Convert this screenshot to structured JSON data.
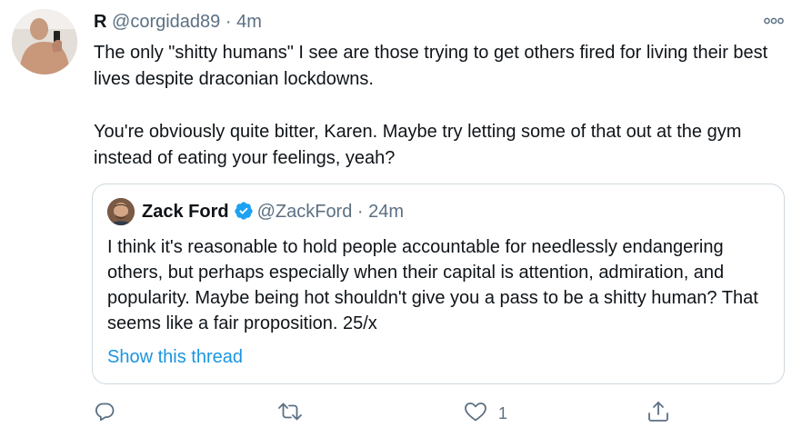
{
  "tweet": {
    "display_name": "R",
    "handle": "@corgidad89",
    "separator": "·",
    "time": "4m",
    "more_icon": "more-dots-icon",
    "paragraphs": [
      "The only \"shitty humans\" I see are those trying to get others fired for living their best lives despite draconian lockdowns.",
      "You're obviously quite bitter, Karen. Maybe try letting some of that out at the gym instead of eating your feelings, yeah?"
    ]
  },
  "quoted_tweet": {
    "display_name": "Zack Ford",
    "verified_icon": "verified-badge-icon",
    "handle": "@ZackFord",
    "separator": "·",
    "time": "24m",
    "text": "I think it's reasonable to hold people accountable for needlessly endangering others, but perhaps especially when their capital is attention, admiration, and popularity. Maybe being hot shouldn't give you a pass to be a shitty human? That seems like a fair proposition. 25/x",
    "show_thread_label": "Show this thread"
  },
  "actions": {
    "reply": {
      "icon": "reply-icon"
    },
    "retweet": {
      "icon": "retweet-icon"
    },
    "like": {
      "icon": "heart-icon",
      "count": "1"
    },
    "share": {
      "icon": "share-icon"
    }
  },
  "colors": {
    "text": "#0f1419",
    "muted": "#5b7083",
    "link": "#1b95e0",
    "verified": "#1da1f2",
    "border": "#cfd9de"
  }
}
